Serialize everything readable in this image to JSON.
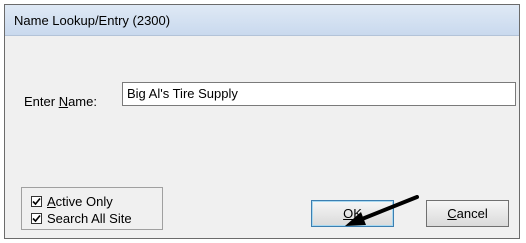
{
  "window": {
    "title": "Name Lookup/Entry (2300)"
  },
  "form": {
    "name_label_prefix": "Enter ",
    "name_label_accel": "N",
    "name_label_suffix": "ame:",
    "name_value": "Big Al's Tire Supply"
  },
  "options": {
    "active_only": {
      "accel": "A",
      "rest": "ctive Only",
      "checked": true
    },
    "search_all_site": {
      "label": "Search All Site",
      "checked": true
    }
  },
  "buttons": {
    "ok_accel": "O",
    "ok_rest": "K",
    "cancel_accel": "C",
    "cancel_rest": "ancel"
  },
  "icons": {
    "checkmark": "checkmark-icon",
    "arrow": "arrow-pointer-icon"
  }
}
